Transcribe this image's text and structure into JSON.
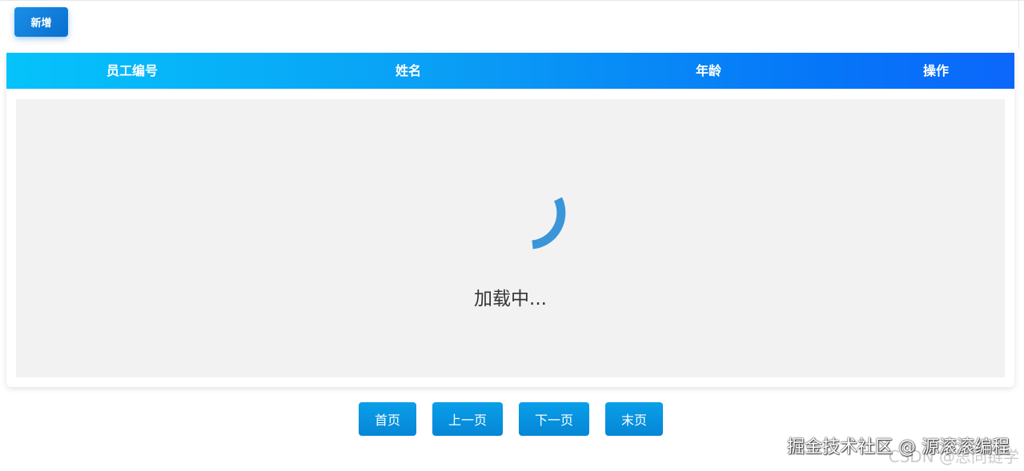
{
  "toolbar": {
    "add_label": "新增"
  },
  "table": {
    "columns": [
      "员工编号",
      "姓名",
      "年龄",
      "操作"
    ],
    "loading_text": "加载中..."
  },
  "pagination": {
    "first_label": "首页",
    "prev_label": "上一页",
    "next_label": "下一页",
    "last_label": "末页"
  },
  "watermark": {
    "front": "掘金技术社区 @ 源滚滚编程",
    "back": "CSDN @思同链学"
  },
  "colors": {
    "header_gradient_start": "#05c3fb",
    "header_gradient_end": "#0b67fb",
    "button_blue": "#0a9fe8",
    "spinner_blue": "#3498db",
    "loading_bg": "#f2f2f2"
  },
  "icons": {
    "spinner": "loading-spinner-icon"
  }
}
